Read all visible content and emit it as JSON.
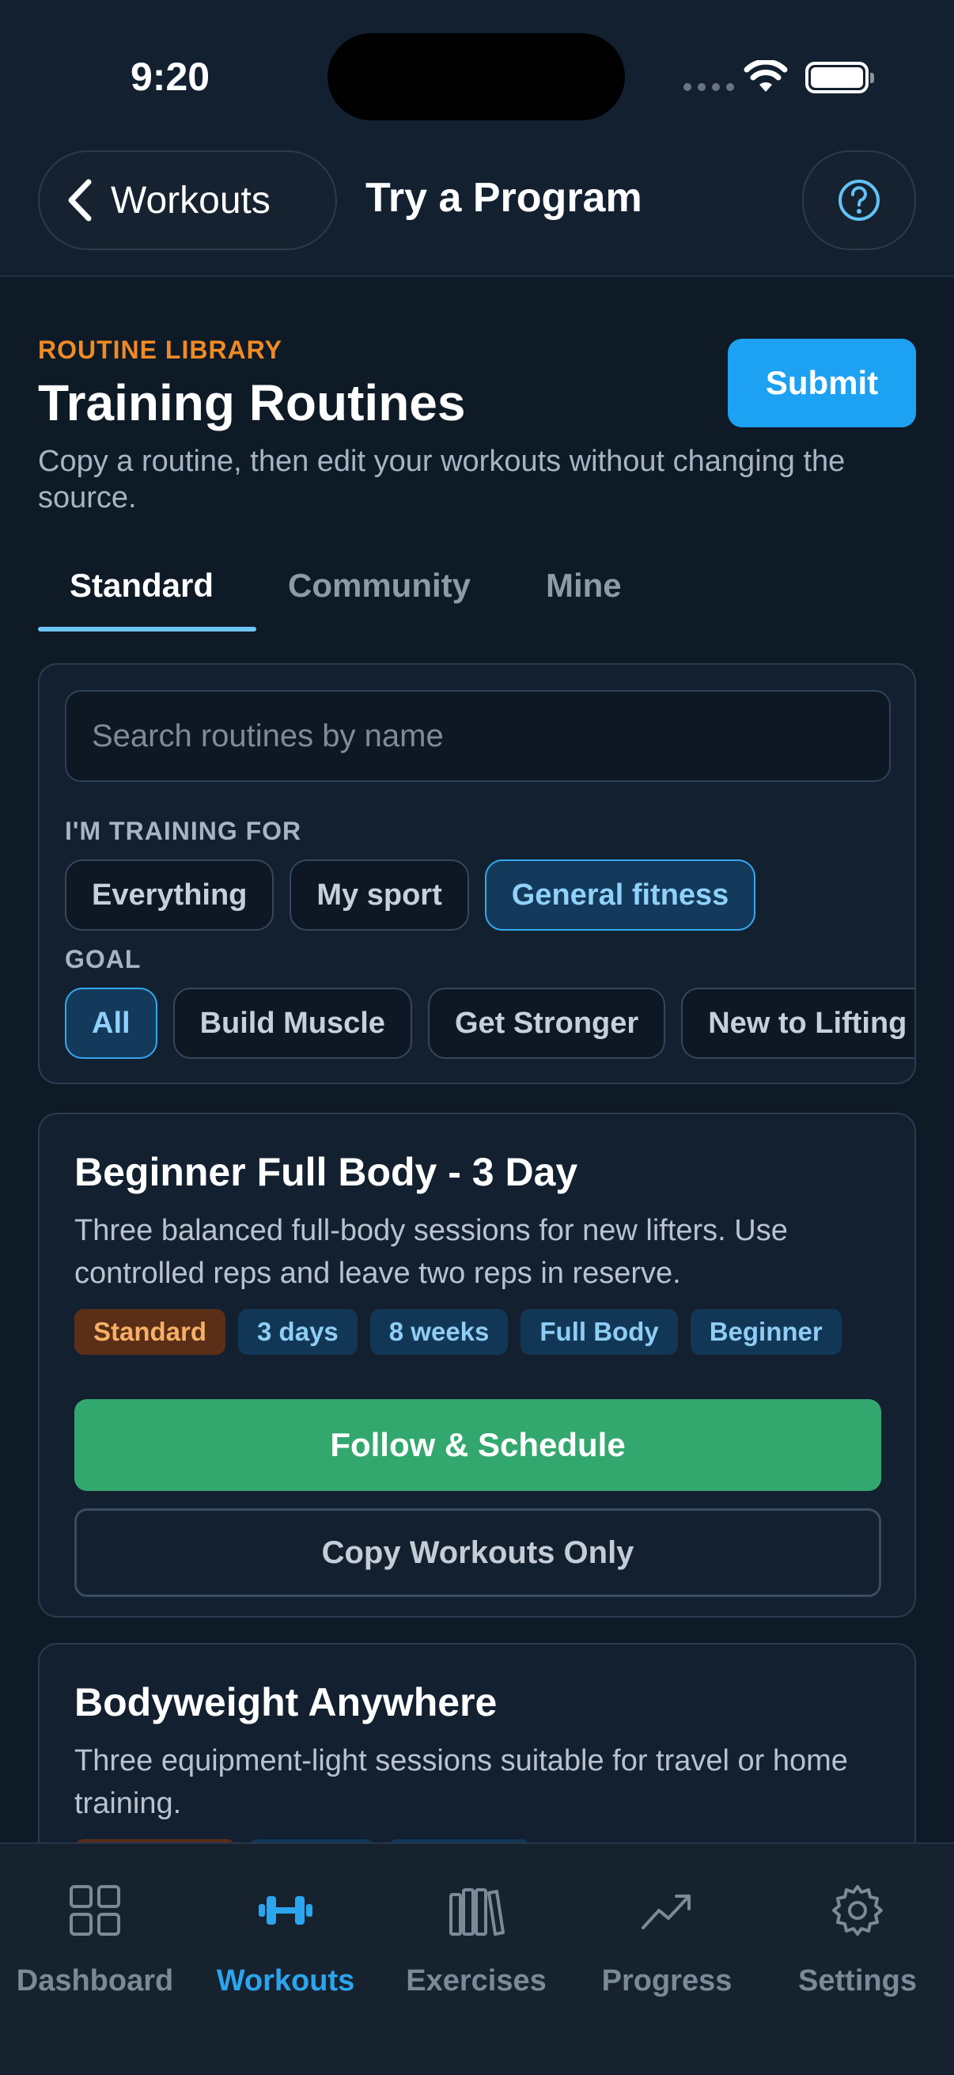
{
  "status_bar": {
    "time": "9:20"
  },
  "nav": {
    "back_label": "Workouts",
    "title": "Try a Program"
  },
  "header": {
    "eyebrow": "ROUTINE LIBRARY",
    "title": "Training Routines",
    "subtitle": "Copy a routine, then edit your workouts without changing the source.",
    "submit_label": "Submit"
  },
  "tabs": [
    {
      "label": "Standard",
      "active": true
    },
    {
      "label": "Community",
      "active": false
    },
    {
      "label": "Mine",
      "active": false
    }
  ],
  "filters": {
    "search_placeholder": "Search routines by name",
    "training_for_label": "I'M TRAINING FOR",
    "training_for": [
      {
        "label": "Everything",
        "selected": false
      },
      {
        "label": "My sport",
        "selected": false
      },
      {
        "label": "General fitness",
        "selected": true
      }
    ],
    "goal_label": "GOAL",
    "goals": [
      {
        "label": "All",
        "selected": true
      },
      {
        "label": "Build Muscle",
        "selected": false
      },
      {
        "label": "Get Stronger",
        "selected": false
      },
      {
        "label": "New to Lifting",
        "selected": false
      }
    ]
  },
  "routines": [
    {
      "title": "Beginner Full Body - 3 Day",
      "description": "Three balanced full-body sessions for new lifters. Use controlled reps and leave two reps in reserve.",
      "badges": [
        "Standard",
        "3 days",
        "8 weeks",
        "Full Body",
        "Beginner"
      ],
      "primary_label": "Follow & Schedule",
      "secondary_label": "Copy Workouts Only"
    },
    {
      "title": "Bodyweight Anywhere",
      "description": "Three equipment-light sessions suitable for travel or home training."
    }
  ],
  "bottom_tabs": [
    {
      "label": "Dashboard",
      "icon": "dashboard-icon",
      "active": false
    },
    {
      "label": "Workouts",
      "icon": "dumbbell-icon",
      "active": true
    },
    {
      "label": "Exercises",
      "icon": "library-icon",
      "active": false
    },
    {
      "label": "Progress",
      "icon": "trend-icon",
      "active": false
    },
    {
      "label": "Settings",
      "icon": "gear-icon",
      "active": false
    }
  ],
  "colors": {
    "background": "#0f1a27",
    "accent_blue": "#1da1f2",
    "accent_green": "#33a86e",
    "accent_orange": "#f08a24"
  }
}
